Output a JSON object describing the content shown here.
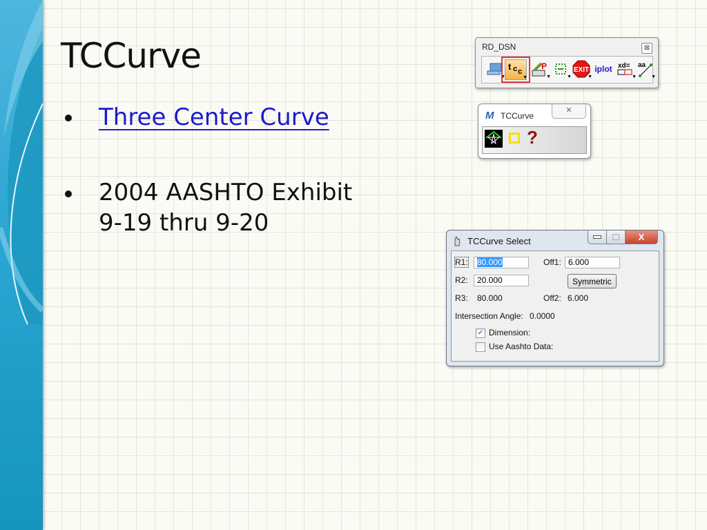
{
  "slide": {
    "title": "TCCurve",
    "bullets": [
      {
        "text": "Three Center Curve",
        "is_link": true
      },
      {
        "line1": "2004 AASHTO Exhibit",
        "line2": "9-19 thru 9-20"
      }
    ]
  },
  "rd_dsn_toolbar": {
    "title": "RD_DSN",
    "close_glyph": "⊠",
    "tools": [
      {
        "icon": "computer-icon"
      },
      {
        "icon": "tcc-icon",
        "label": "tcc",
        "selected": true
      },
      {
        "icon": "profile-edit-icon"
      },
      {
        "icon": "grid-select-icon"
      },
      {
        "icon": "exit-icon",
        "label": "EXIT"
      },
      {
        "icon": "iplot-icon",
        "label": "iplot"
      },
      {
        "icon": "xd-dimension-icon",
        "label": "xd="
      },
      {
        "icon": "annotate-line-icon",
        "label": "aa"
      }
    ]
  },
  "tccurve_window": {
    "title": "TCCurve",
    "close_glyph": "✕",
    "help_glyph": "?"
  },
  "tccurve_select_dialog": {
    "title": "TCCurve Select",
    "caption_close": "X",
    "fields": {
      "r1_label": "R1:",
      "r1_value": "80.000",
      "off1_label": "Off1:",
      "off1_value": "6.000",
      "r2_label": "R2:",
      "r2_value": "20.000",
      "symmetric_button": "Symmetric",
      "r3_label": "R3:",
      "r3_value": "80.000",
      "off2_label": "Off2:",
      "off2_value": "6.000",
      "angle_label": "Intersection Angle:",
      "angle_value": "0.0000"
    },
    "checkboxes": [
      {
        "label": "Dimension:",
        "checked": true,
        "mark": "✓"
      },
      {
        "label": "Use Aashto Data:",
        "checked": false,
        "mark": ""
      }
    ]
  },
  "colors": {
    "sidebar": "#2aa6d2",
    "link": "#1a1ad0",
    "highlight_border": "#e33333",
    "close_red": "#c7432a"
  }
}
